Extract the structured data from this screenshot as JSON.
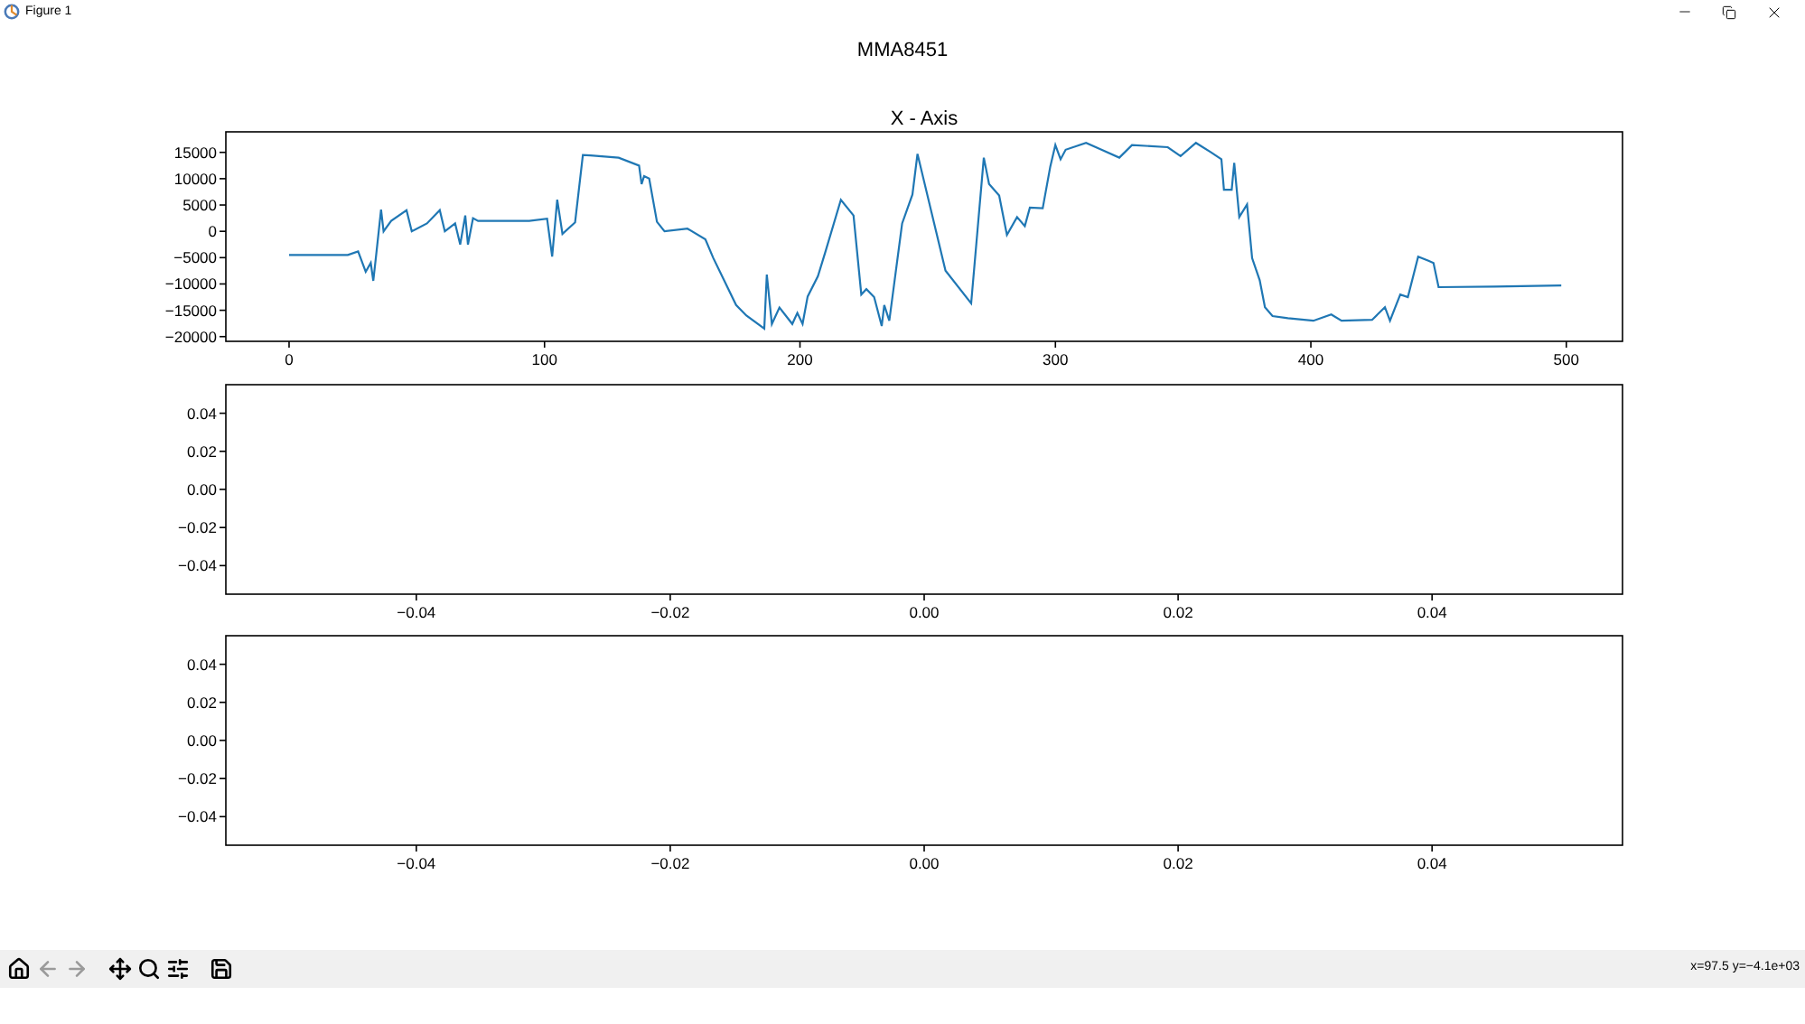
{
  "window": {
    "title": "Figure 1"
  },
  "figure": {
    "title": "MMA8451",
    "axes": [
      {
        "chart_data": {
          "type": "line",
          "title": "X - Axis",
          "xlim": [
            -24.75,
            522
          ],
          "ylim": [
            -20900,
            18900
          ],
          "xticks": [
            0,
            100,
            200,
            300,
            400,
            500
          ],
          "yticks": [
            {
              "value": 15000,
              "label": "15000"
            },
            {
              "value": 10000,
              "label": "10000"
            },
            {
              "value": 5000,
              "label": "5000"
            },
            {
              "value": 0,
              "label": "0"
            },
            {
              "value": -5000,
              "label": "−5000"
            },
            {
              "value": -10000,
              "label": "−10000"
            },
            {
              "value": -15000,
              "label": "−15000"
            },
            {
              "value": -20000,
              "label": "−20000"
            }
          ],
          "x": [
            0,
            23,
            27,
            30,
            32,
            33,
            34,
            36,
            37,
            40,
            46,
            48,
            54,
            59,
            61,
            65,
            67,
            69,
            70,
            72,
            74,
            94,
            101,
            103,
            105,
            107,
            112,
            115,
            118,
            129,
            137,
            138,
            139,
            141,
            144,
            147,
            156,
            163,
            166,
            170,
            175,
            179,
            186,
            187,
            189,
            192,
            197,
            199,
            201,
            203,
            207,
            210,
            216,
            221,
            224,
            226,
            229,
            232,
            233,
            235,
            240,
            244,
            246,
            257,
            267,
            272,
            274,
            278,
            281,
            285,
            288,
            290,
            295,
            298,
            300,
            302,
            304,
            312,
            318,
            325,
            330,
            344,
            349,
            355,
            361,
            365,
            366,
            369,
            370,
            372,
            375,
            377,
            380,
            382,
            385,
            391,
            401,
            408,
            412,
            424,
            429,
            431,
            435,
            438,
            442,
            446,
            448,
            450,
            472,
            498
          ],
          "series": [
            {
              "color": "#1f77b4",
              "values": [
                -4500,
                -4500,
                -3800,
                -7700,
                -6000,
                -9400,
                -4800,
                4100,
                0,
                2000,
                4000,
                0,
                1500,
                4000,
                0,
                1500,
                -2500,
                3000,
                -2500,
                2500,
                2000,
                2000,
                2400,
                -4800,
                6000,
                -500,
                1700,
                14500,
                14400,
                14000,
                12500,
                9000,
                10500,
                10000,
                1800,
                0,
                500,
                -1500,
                -5000,
                -9000,
                -14000,
                -16000,
                -18500,
                -8200,
                -17600,
                -14500,
                -17600,
                -15500,
                -17600,
                -12400,
                -8500,
                -3800,
                6000,
                3000,
                -12000,
                -11000,
                -12500,
                -18000,
                -14000,
                -17000,
                1500,
                7000,
                14700,
                -7500,
                -13700,
                14000,
                9000,
                6800,
                -700,
                2700,
                1000,
                4500,
                4400,
                12300,
                16400,
                13700,
                15500,
                16800,
                15500,
                14000,
                16400,
                16000,
                14300,
                16800,
                15000,
                13700,
                7900,
                7900,
                13000,
                2700,
                5100,
                -5100,
                -9300,
                -14400,
                -16100,
                -16500,
                -17000,
                -15800,
                -17000,
                -16800,
                -14400,
                -17000,
                -12000,
                -12500,
                -4800,
                -5600,
                -6000,
                -10600,
                -10500,
                -10300
              ]
            }
          ]
        }
      },
      {
        "chart_data": {
          "type": "line",
          "xlim": [
            -0.055,
            0.055
          ],
          "ylim": [
            -0.055,
            0.055
          ],
          "xticks": [
            {
              "value": -0.04,
              "label": "−0.04"
            },
            {
              "value": -0.02,
              "label": "−0.02"
            },
            {
              "value": 0,
              "label": "0.00"
            },
            {
              "value": 0.02,
              "label": "0.02"
            },
            {
              "value": 0.04,
              "label": "0.04"
            }
          ],
          "yticks": [
            {
              "value": 0.04,
              "label": "0.04"
            },
            {
              "value": 0.02,
              "label": "0.02"
            },
            {
              "value": 0,
              "label": "0.00"
            },
            {
              "value": -0.02,
              "label": "−0.02"
            },
            {
              "value": -0.04,
              "label": "−0.04"
            }
          ]
        }
      },
      {
        "chart_data": {
          "type": "line",
          "xlim": [
            -0.055,
            0.055
          ],
          "ylim": [
            -0.055,
            0.055
          ],
          "xticks": [
            {
              "value": -0.04,
              "label": "−0.04"
            },
            {
              "value": -0.02,
              "label": "−0.02"
            },
            {
              "value": 0,
              "label": "0.00"
            },
            {
              "value": 0.02,
              "label": "0.02"
            },
            {
              "value": 0.04,
              "label": "0.04"
            }
          ],
          "yticks": [
            {
              "value": 0.04,
              "label": "0.04"
            },
            {
              "value": 0.02,
              "label": "0.02"
            },
            {
              "value": 0,
              "label": "0.00"
            },
            {
              "value": -0.02,
              "label": "−0.02"
            },
            {
              "value": -0.04,
              "label": "−0.04"
            }
          ]
        }
      }
    ]
  },
  "toolbar": [
    {
      "kind": "home",
      "disabled": false
    },
    {
      "kind": "back",
      "disabled": true
    },
    {
      "kind": "forward",
      "disabled": true
    },
    {
      "kind": "pan",
      "disabled": false
    },
    {
      "kind": "zoom",
      "disabled": false
    },
    {
      "kind": "configure",
      "disabled": false
    },
    {
      "kind": "save",
      "disabled": false
    }
  ],
  "status_bar": {
    "text": "x=97.5 y=−4.1e+03"
  }
}
